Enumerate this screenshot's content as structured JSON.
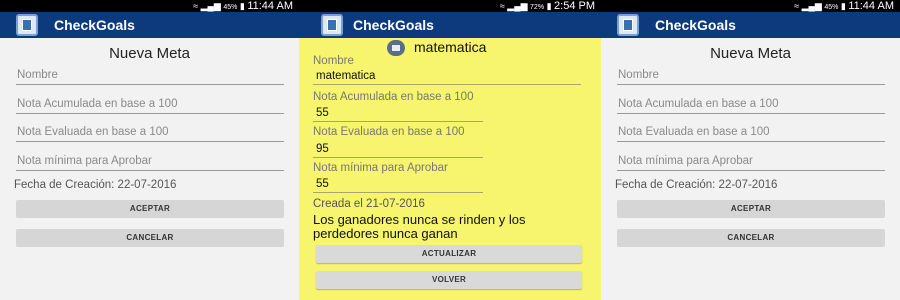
{
  "app": {
    "title": "CheckGoals"
  },
  "screens": [
    {
      "status": {
        "percent": "45%",
        "time": "11:44 AM"
      },
      "title": "Nueva Meta",
      "fields": [
        "Nombre",
        "Nota Acumulada en base a 100",
        "Nota Evaluada en base a 100",
        "Nota mínima para Aprobar"
      ],
      "fecha": "Fecha de Creación: 22-07-2016",
      "accept": "ACEPTAR",
      "cancel": "CANCELAR"
    },
    {
      "status": {
        "percent": "72%",
        "time": "2:54 PM"
      },
      "goal_name": "matematica",
      "fields": [
        {
          "label": "Nombre",
          "value": "matematica"
        },
        {
          "label": "Nota Acumulada en base a 100",
          "value": "55"
        },
        {
          "label": "Nota Evaluada en base a 100",
          "value": "95"
        },
        {
          "label": "Nota mínima para Aprobar",
          "value": "55"
        }
      ],
      "created": "Creada el 21-07-2016",
      "quote": "Los ganadores nunca se rinden y los perdedores nunca ganan",
      "update": "ACTUALIZAR",
      "back": "VOLVER"
    },
    {
      "status": {
        "percent": "45%",
        "time": "11:44 AM"
      },
      "title": "Nueva Meta",
      "fields": [
        "Nombre",
        "Nota Acumulada en base a 100",
        "Nota Evaluada en base a 100",
        "Nota mínima para Aprobar"
      ],
      "fecha": "Fecha de Creación: 22-07-2016",
      "accept": "ACEPTAR",
      "cancel": "CANCELAR"
    }
  ],
  "colors": {
    "appbar": "#0d3a7c",
    "highlight_bg": "#f7f46d",
    "screen_bg": "#f2f2f2"
  }
}
